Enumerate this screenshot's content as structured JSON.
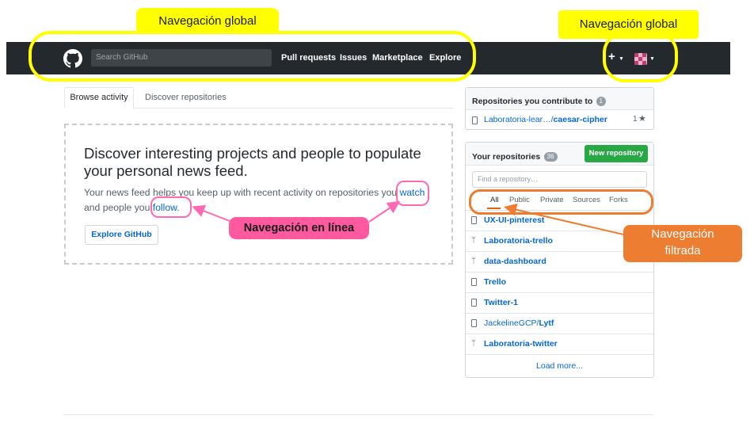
{
  "annotations": {
    "global_nav_left": "Navegación global",
    "global_nav_right": "Navegación global",
    "inline_nav": "Navegación en línea",
    "filtered_nav_line1": "Navegación",
    "filtered_nav_line2": "filtrada"
  },
  "header": {
    "search_placeholder": "Search GitHub",
    "nav": [
      "Pull requests",
      "Issues",
      "Marketplace",
      "Explore"
    ],
    "plus_label": "+"
  },
  "feed": {
    "tabs": [
      "Browse activity",
      "Discover repositories"
    ],
    "title": "Discover interesting projects and people to populate your personal news feed.",
    "text_part1": "Your news feed helps you keep up with recent activity on repositories you ",
    "watch_link": "watch",
    "text_part2": "and people you ",
    "follow_link": "follow",
    "text_part3": ".",
    "explore_button": "Explore GitHub"
  },
  "contribute": {
    "title": "Repositories you contribute to",
    "count": "1",
    "repo": "Laboratoria-lear…/caesar-cipher",
    "repo_owner": "Laboratoria-lear…/",
    "repo_name": "caesar-cipher",
    "stars": "1"
  },
  "repos": {
    "title": "Your repositories",
    "count": "36",
    "new_button": "New repository",
    "find_placeholder": "Find a repository…",
    "filters": [
      "All",
      "Public",
      "Private",
      "Sources",
      "Forks"
    ],
    "items": [
      {
        "name": "UX-UI-pinterest",
        "icon": "repo-icon"
      },
      {
        "name": "Laboratoria-trello",
        "icon": "fork-icon"
      },
      {
        "name": "data-dashboard",
        "icon": "fork-icon"
      },
      {
        "name": "Trello",
        "icon": "repo-icon"
      },
      {
        "name": "Twitter-1",
        "icon": "repo-icon"
      },
      {
        "owner": "JackelineGCP/",
        "name": "Lytf",
        "icon": "repo-icon"
      },
      {
        "name": "Laboratoria-twitter",
        "icon": "fork-icon"
      }
    ],
    "load_more": "Load more..."
  },
  "colors": {
    "header_bg": "#24292e",
    "link": "#0366d6",
    "green": "#28a745",
    "annotation_yellow": "#ffff00",
    "annotation_pink": "#ff5aa0",
    "annotation_orange": "#ed7d31"
  }
}
